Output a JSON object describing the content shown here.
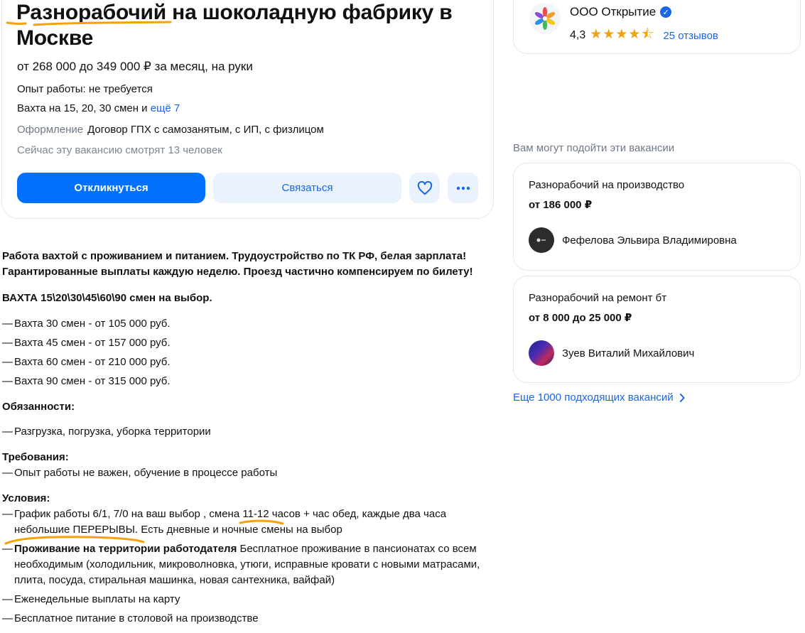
{
  "vacancy": {
    "title": "Разнорабочий на шоколадную фабрику в Москве",
    "salary": "от 268 000 до 349 000 ₽ за месяц, на руки",
    "experience": "Опыт работы: не требуется",
    "shift_text": "Вахта на 15, 20, 30 смен и",
    "shift_more": "ещё 7",
    "employment_label": "Оформление",
    "employment_value": "Договор ГПХ с самозанятым, с ИП, с физлицом",
    "viewers": "Сейчас эту вакансию смотрят 13 человек",
    "apply_label": "Откликнуться",
    "contact_label": "Связаться",
    "favorite_icon": "heart-icon",
    "more_icon": "ellipsis-icon"
  },
  "description": {
    "intro_line1": "Работа вахтой с проживанием и питанием. Трудоустройство по ТК РФ, белая зарплата!",
    "intro_line2": "Гарантированные выплаты каждую неделю. Проезд частично компенсируем по билету!",
    "shift_heading": "ВАХТА 15\\20\\30\\45\\60\\90 смен на выбор.",
    "shifts": [
      "Вахта 30 смен - от 105 000 руб.",
      "Вахта 45 смен - от 157 000 руб.",
      "Вахта 60 смен - от 210 000 руб.",
      "Вахта 90 смен - от 315 000 руб."
    ],
    "duties_heading": "Обязанности:",
    "duties": [
      "Разгрузка, погрузка, уборка территории"
    ],
    "requirements_heading": "Требования:",
    "requirements": [
      "Опыт работы не важен, обучение в процессе работы"
    ],
    "conditions_heading": "Условия:",
    "conditions_1": "График работы 6/1, 7/0 на ваш выбор , смена 11-12 часов + час обед, каждые два часа небольшие ПЕРЕРЫВЫ. Есть дневные и ночные смены на выбор",
    "conditions_2_bold": "Проживание на территории работодателя",
    "conditions_2_rest": " Бесплатное проживание в пансионатах со всем необходимым (холодильник, микроволновка, утюги, исправные кровати с новыми матрасами, плита, посуда, стиральная машинка, новая сантехника, вайфай)",
    "conditions_3": "Еженедельные выплаты на карту",
    "conditions_4": "Бесплатное питание в столовой на производстве",
    "dash": "—"
  },
  "employer": {
    "name": "ООО Открытие",
    "rating": "4,3",
    "stars": "★★★★⯪",
    "reviews": "25 отзывов"
  },
  "sidebar": {
    "heading": "Вам могут подойти эти вакансии",
    "cards": [
      {
        "title": "Разнорабочий на производство",
        "salary": "от 186 000 ₽",
        "person": "Фефелова Эльвира Владимировна"
      },
      {
        "title": "Разнорабочий на ремонт бт",
        "salary": "от 8 000 до 25 000 ₽",
        "person": "Зуев Виталий Михайлович"
      }
    ],
    "more_link": "Еще 1000 подходящих вакансий"
  },
  "colors": {
    "accent": "#0070ff",
    "link": "#1a66e8",
    "star": "#f2a20c",
    "ink": "#f5a20a"
  }
}
